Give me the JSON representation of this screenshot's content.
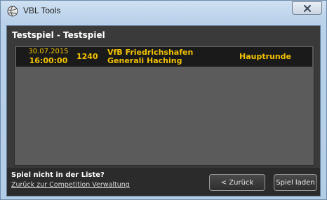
{
  "window": {
    "title": "VBL Tools",
    "close_icon": "close-icon",
    "app_icon": "volleyball-app-icon"
  },
  "heading": "Testspiel - Testspiel",
  "games": [
    {
      "date": "30.07.2015",
      "time": "16:00:00",
      "number": "1240",
      "team_home": "VfB Friedrichshafen",
      "team_away": "Generali Haching",
      "round": "Hauptrunde"
    }
  ],
  "footer": {
    "not_in_list": "Spiel nicht in der Liste?",
    "back_link": "Zurück zur Competition Verwaltung",
    "back_button": "< Zurück",
    "load_button": "Spiel laden"
  },
  "colors": {
    "highlight_text": "#f2c200",
    "list_background": "#5b5b5b",
    "panel_background": "#3a3a3a"
  }
}
